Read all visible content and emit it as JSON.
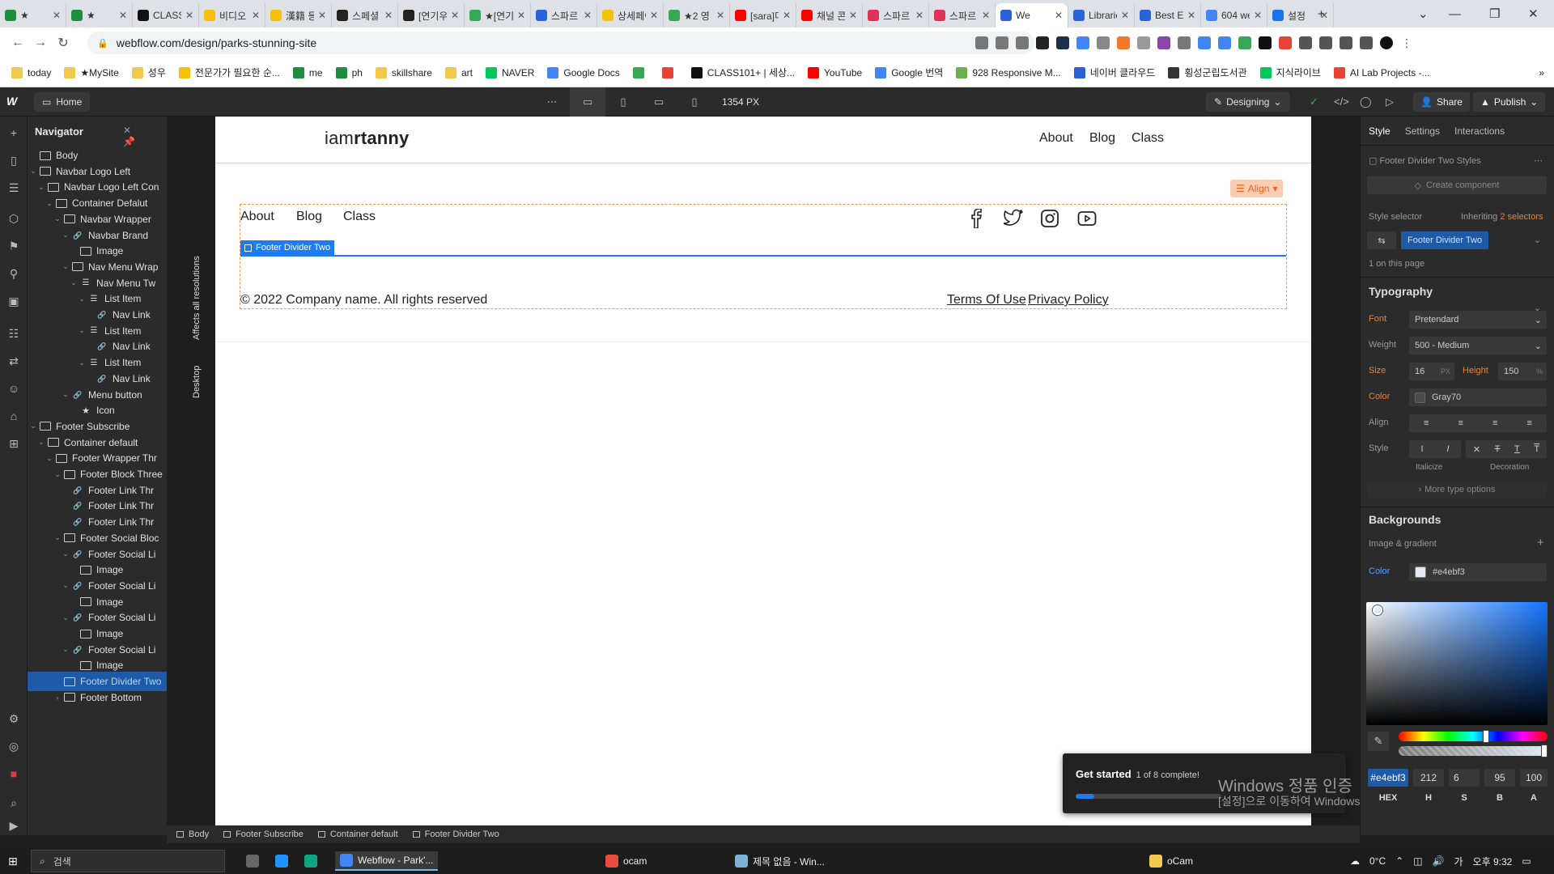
{
  "browser": {
    "tabs": [
      {
        "label": "★",
        "color": "#1e8e3e"
      },
      {
        "label": "★",
        "color": "#1e8e3e"
      },
      {
        "label": "CLASS1",
        "color": "#111111"
      },
      {
        "label": "비디오",
        "color": "#f4c20d"
      },
      {
        "label": "漢籍 등",
        "color": "#f4c20d"
      },
      {
        "label": "스페셜",
        "color": "#222222"
      },
      {
        "label": "[연기우",
        "color": "#222222"
      },
      {
        "label": "★[연기",
        "color": "#34a853"
      },
      {
        "label": "스파르",
        "color": "#2a62d8"
      },
      {
        "label": "상세페이",
        "color": "#f4c20d"
      },
      {
        "label": "★2 영",
        "color": "#34a853"
      },
      {
        "label": "[sara]미",
        "color": "#ff0000"
      },
      {
        "label": "채널 콘",
        "color": "#ff0000"
      },
      {
        "label": "스파르",
        "color": "#e0315a"
      },
      {
        "label": "스파르",
        "color": "#e0315a"
      },
      {
        "label": "We",
        "color": "#2a62d8"
      },
      {
        "label": "Librarie",
        "color": "#2a62d8"
      },
      {
        "label": "Best Ec",
        "color": "#2a62d8"
      },
      {
        "label": "604 we",
        "color": "#4285f4"
      },
      {
        "label": "설정",
        "color": "#1a73e8"
      }
    ],
    "url": "webflow.com/design/parks-stunning-site",
    "bookmarks": [
      {
        "label": "today",
        "color": "#f2c94c"
      },
      {
        "label": "★MySite",
        "color": "#f2c94c"
      },
      {
        "label": "성우",
        "color": "#f2c94c"
      },
      {
        "label": "전문가가 필요한 순...",
        "color": "#f4c20d"
      },
      {
        "label": "me",
        "color": "#1e8e3e"
      },
      {
        "label": "ph",
        "color": "#1e8e3e"
      },
      {
        "label": "skillshare",
        "color": "#f2c94c"
      },
      {
        "label": "art",
        "color": "#f2c94c"
      },
      {
        "label": "NAVER",
        "color": "#03c75a"
      },
      {
        "label": "Google Docs",
        "color": "#4285f4"
      },
      {
        "label": "",
        "color": "#34a853"
      },
      {
        "label": "",
        "color": "#ea4335"
      },
      {
        "label": "CLASS101+ | 세상...",
        "color": "#111111"
      },
      {
        "label": "YouTube",
        "color": "#ff0000"
      },
      {
        "label": "Google 번역",
        "color": "#4285f4"
      },
      {
        "label": "928 Responsive M...",
        "color": "#6ab04c"
      },
      {
        "label": "네이버 클라우드",
        "color": "#2a62d8"
      },
      {
        "label": "횡성군립도서관",
        "color": "#333333"
      },
      {
        "label": "지식라이브",
        "color": "#03c75a"
      },
      {
        "label": "AI Lab Projects -...",
        "color": "#ea4335"
      }
    ]
  },
  "topbar": {
    "logo": "W",
    "page": "Home",
    "width_label": "1354 PX",
    "mode": "Designing",
    "share": "Share",
    "publish": "Publish"
  },
  "navigator": {
    "title": "Navigator",
    "items": [
      {
        "label": "Body",
        "depth": 0,
        "icon": "box",
        "caret": ""
      },
      {
        "label": "Navbar Logo Left",
        "depth": 0,
        "icon": "box",
        "caret": "v"
      },
      {
        "label": "Navbar Logo Left Con",
        "depth": 1,
        "icon": "box",
        "caret": "v"
      },
      {
        "label": "Container Defalut",
        "depth": 2,
        "icon": "box",
        "caret": "v"
      },
      {
        "label": "Navbar Wrapper",
        "depth": 3,
        "icon": "box",
        "caret": "v"
      },
      {
        "label": "Navbar Brand",
        "depth": 4,
        "icon": "link",
        "caret": "v"
      },
      {
        "label": "Image",
        "depth": 5,
        "icon": "img",
        "caret": ""
      },
      {
        "label": "Nav Menu Wrap",
        "depth": 4,
        "icon": "box",
        "caret": "v"
      },
      {
        "label": "Nav Menu Tw",
        "depth": 5,
        "icon": "list",
        "caret": "v"
      },
      {
        "label": "List Item",
        "depth": 6,
        "icon": "list",
        "caret": "v"
      },
      {
        "label": "Nav Link",
        "depth": 7,
        "icon": "link",
        "caret": ""
      },
      {
        "label": "List Item",
        "depth": 6,
        "icon": "list",
        "caret": "v"
      },
      {
        "label": "Nav Link",
        "depth": 7,
        "icon": "link",
        "caret": ""
      },
      {
        "label": "List Item",
        "depth": 6,
        "icon": "list",
        "caret": "v"
      },
      {
        "label": "Nav Link",
        "depth": 7,
        "icon": "link",
        "caret": ""
      },
      {
        "label": "Menu button",
        "depth": 4,
        "icon": "link",
        "caret": "v"
      },
      {
        "label": "Icon",
        "depth": 5,
        "icon": "star",
        "caret": ""
      },
      {
        "label": "Footer Subscribe",
        "depth": 0,
        "icon": "box",
        "caret": "v"
      },
      {
        "label": "Container default",
        "depth": 1,
        "icon": "box",
        "caret": "v"
      },
      {
        "label": "Footer Wrapper Thr",
        "depth": 2,
        "icon": "box",
        "caret": "v"
      },
      {
        "label": "Footer Block Three",
        "depth": 3,
        "icon": "box",
        "caret": "v"
      },
      {
        "label": "Footer Link Thr",
        "depth": 4,
        "icon": "link",
        "caret": ""
      },
      {
        "label": "Footer Link Thr",
        "depth": 4,
        "icon": "link",
        "caret": ""
      },
      {
        "label": "Footer Link Thr",
        "depth": 4,
        "icon": "link",
        "caret": ""
      },
      {
        "label": "Footer Social Bloc",
        "depth": 3,
        "icon": "box",
        "caret": "v"
      },
      {
        "label": "Footer Social Li",
        "depth": 4,
        "icon": "link",
        "caret": "v"
      },
      {
        "label": "Image",
        "depth": 5,
        "icon": "img",
        "caret": ""
      },
      {
        "label": "Footer Social Li",
        "depth": 4,
        "icon": "link",
        "caret": "v"
      },
      {
        "label": "Image",
        "depth": 5,
        "icon": "img",
        "caret": ""
      },
      {
        "label": "Footer Social Li",
        "depth": 4,
        "icon": "link",
        "caret": "v"
      },
      {
        "label": "Image",
        "depth": 5,
        "icon": "img",
        "caret": ""
      },
      {
        "label": "Footer Social Li",
        "depth": 4,
        "icon": "link",
        "caret": "v"
      },
      {
        "label": "Image",
        "depth": 5,
        "icon": "img",
        "caret": ""
      },
      {
        "label": "Footer Divider Two",
        "depth": 3,
        "icon": "box",
        "caret": "",
        "selected": true
      },
      {
        "label": "Footer Bottom",
        "depth": 3,
        "icon": "box",
        "caret": ">"
      }
    ]
  },
  "breakpoint_strip": {
    "affects": "Affects all resolutions",
    "device": "Desktop"
  },
  "site": {
    "brand_light": "iam",
    "brand_bold": "rtanny",
    "nav": [
      "About",
      "Blog",
      "Class"
    ],
    "align_label": "Align",
    "footer_links": [
      "About",
      "Blog",
      "Class"
    ],
    "selected_label": "Footer Divider Two",
    "copyright": "© 2022 Company name. All rights reserved",
    "terms": "Terms Of Use",
    "privacy": "Privacy Policy",
    "social_icons": [
      "facebook-icon",
      "twitter-icon",
      "instagram-icon",
      "youtube-icon"
    ]
  },
  "toast": {
    "title": "Get started",
    "progress": "1 of 8 complete!",
    "progress_fraction": 0.125
  },
  "watermark": {
    "line1": "Windows 정품 인증",
    "line2": "[설정]으로 이동하여 Windows 정품 인증합니다."
  },
  "rightpanel": {
    "tabs": [
      "Style",
      "Settings",
      "Interactions"
    ],
    "styles_header": "Footer Divider Two Styles",
    "create_component": "Create component",
    "style_selector": "Style selector",
    "inheriting": "Inheriting",
    "inheriting_count": "2 selectors",
    "selector_chip": "Footer Divider Two",
    "on_page": "1 on this page",
    "typography": "Typography",
    "font_label": "Font",
    "font": "Pretendard",
    "weight_label": "Weight",
    "weight": "500 - Medium",
    "size_label": "Size",
    "size": "16",
    "size_unit": "PX",
    "height_label": "Height",
    "height": "150",
    "height_unit": "%",
    "color_label": "Color",
    "color_name": "Gray70",
    "align_label": "Align",
    "style_label": "Style",
    "italicize": "Italicize",
    "decoration": "Decoration",
    "more_type": "More type options",
    "backgrounds": "Backgrounds",
    "image_gradient": "Image & gradient",
    "bg_color_label": "Color",
    "bg_color": "#e4ebf3"
  },
  "picker": {
    "hex": "#e4ebf3",
    "h": "212",
    "s": "6",
    "b": "95",
    "a": "100",
    "labels": [
      "HEX",
      "H",
      "S",
      "B",
      "A"
    ]
  },
  "breadcrumbs": [
    "Body",
    "Footer Subscribe",
    "Container default",
    "Footer Divider Two"
  ],
  "taskbar": {
    "search": "검색",
    "apps": [
      {
        "label": "Webflow - Park'...",
        "color": "#4285f4",
        "active": true
      },
      {
        "label": "ocam",
        "color": "#e74c3c"
      },
      {
        "label": "제목 없음 - Win...",
        "color": "#7fb3d5"
      },
      {
        "label": "oCam",
        "color": "#f2c94c"
      }
    ],
    "temp": "0°C",
    "ime": "가",
    "time": "오후 9:32"
  }
}
